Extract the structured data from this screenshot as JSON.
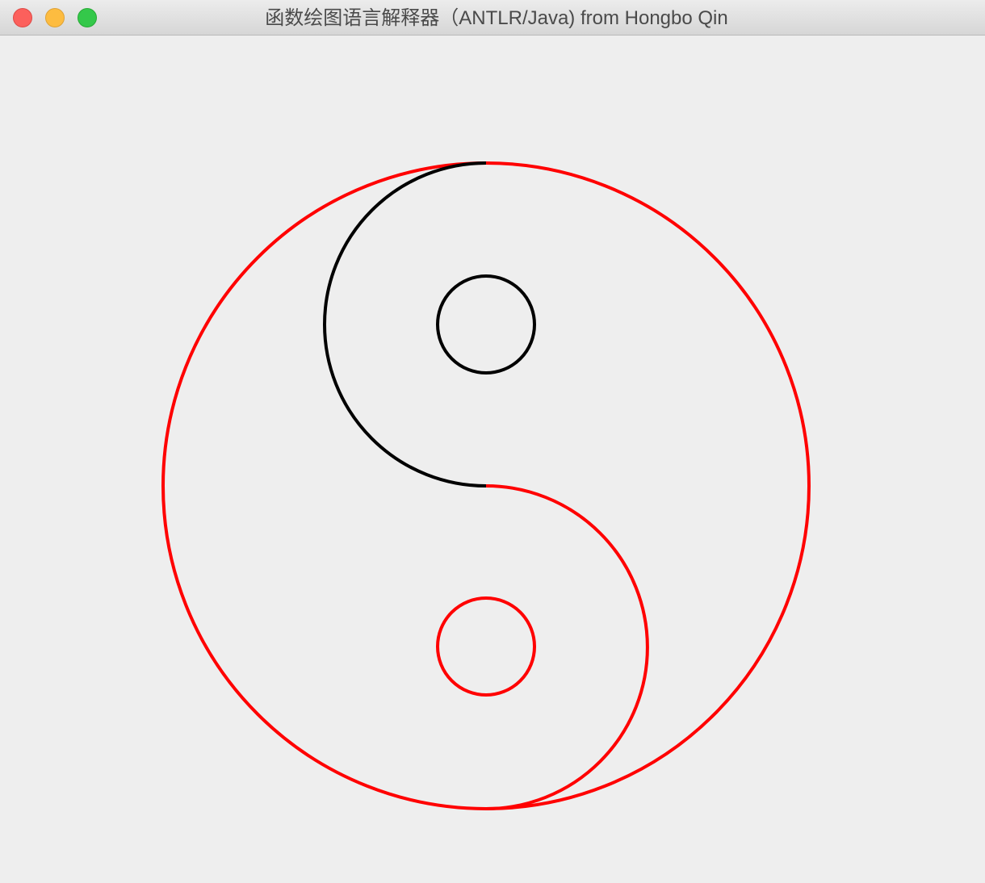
{
  "window": {
    "title": "函数绘图语言解释器（ANTLR/Java) from Hongbo Qin",
    "buttons": {
      "close": "close-button",
      "minimize": "minimize-button",
      "maximize": "maximize-button"
    }
  },
  "drawing": {
    "background": "#eeeeee",
    "colors": {
      "red": "#ff0000",
      "black": "#000000"
    }
  }
}
